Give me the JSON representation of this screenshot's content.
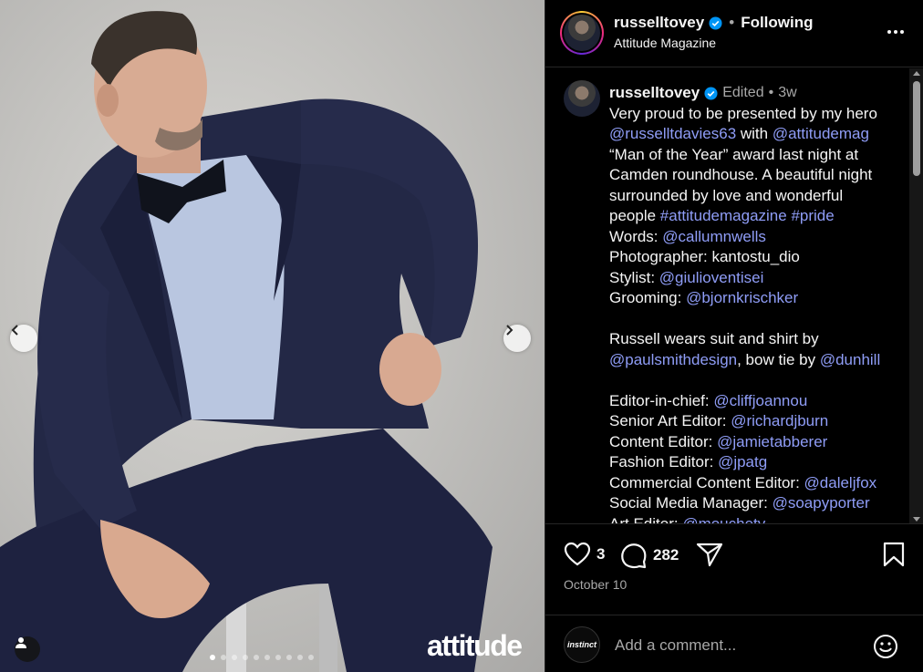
{
  "post": {
    "username": "russelltovey",
    "separator": "•",
    "follow_state": "Following",
    "location": "Attitude Magazine",
    "watermark": "attitude",
    "slides_total": 10,
    "slide_active": 1
  },
  "caption": {
    "username": "russelltovey",
    "edited": "Edited",
    "dot": "•",
    "age": "3w",
    "lines": [
      [
        {
          "t": "Very proud to be presented by my hero"
        }
      ],
      [
        {
          "t": "@russelltdavies63",
          "link": true
        },
        {
          "t": " with "
        },
        {
          "t": "@attitudemag",
          "link": true
        }
      ],
      [
        {
          "t": "“Man of the Year” award last night at"
        }
      ],
      [
        {
          "t": "Camden roundhouse. A beautiful night"
        }
      ],
      [
        {
          "t": "surrounded by love and wonderful"
        }
      ],
      [
        {
          "t": "people "
        },
        {
          "t": "#attitudemagazine",
          "link": true
        },
        {
          "t": " "
        },
        {
          "t": "#pride",
          "link": true
        }
      ],
      [
        {
          "t": "Words: "
        },
        {
          "t": "@callumnwells",
          "link": true
        }
      ],
      [
        {
          "t": "Photographer: kantostu_dio"
        }
      ],
      [
        {
          "t": "Stylist: "
        },
        {
          "t": "@giulioventisei",
          "link": true
        }
      ],
      [
        {
          "t": "Grooming: "
        },
        {
          "t": "@bjornkrischker",
          "link": true
        }
      ],
      [],
      [
        {
          "t": "Russell wears suit and shirt by"
        }
      ],
      [
        {
          "t": "@paulsmithdesign",
          "link": true
        },
        {
          "t": ", bow tie by "
        },
        {
          "t": "@dunhill",
          "link": true
        }
      ],
      [],
      [
        {
          "t": "Editor-in-chief: "
        },
        {
          "t": "@cliffjoannou",
          "link": true
        }
      ],
      [
        {
          "t": "Senior Art Editor: "
        },
        {
          "t": "@richardjburn",
          "link": true
        }
      ],
      [
        {
          "t": "Content Editor: "
        },
        {
          "t": "@jamietabberer",
          "link": true
        }
      ],
      [
        {
          "t": "Fashion Editor: "
        },
        {
          "t": "@jpatg",
          "link": true
        }
      ],
      [
        {
          "t": "Commercial Content Editor: "
        },
        {
          "t": "@daleljfox",
          "link": true
        }
      ],
      [
        {
          "t": "Social Media Manager: "
        },
        {
          "t": "@soapyporter",
          "link": true
        }
      ],
      [
        {
          "t": "Art Editor: "
        },
        {
          "t": "@mouchety",
          "link": true
        }
      ]
    ]
  },
  "actions": {
    "likes": "3",
    "comments": "282"
  },
  "date": "October 10",
  "comment_box": {
    "avatar_text": "instinct",
    "placeholder": "Add a comment..."
  },
  "colors": {
    "link": "#8f9df7",
    "verified": "#0095f6",
    "suit": "#232846",
    "shirt": "#b9c6e0"
  }
}
